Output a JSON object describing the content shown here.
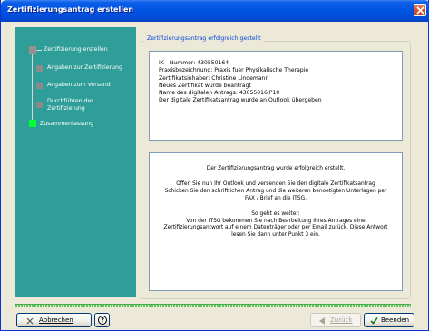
{
  "window": {
    "title": "Zertifizierungsantrag erstellen"
  },
  "sidebar": {
    "steps": [
      {
        "label": "Zertifizierung erstellen"
      },
      {
        "label": "Angaben zur Zertifizierung"
      },
      {
        "label": "Angaben zum Versand"
      },
      {
        "label_line1": "Durchführen der",
        "label_line2": "Zertifizierung"
      },
      {
        "label": "Zusammenfassung",
        "active": true
      }
    ]
  },
  "group": {
    "legend": "Zertifizierungsantrag erfolgreich gestellt"
  },
  "info": {
    "lines": [
      "IK - Nummer: 430550164",
      "Praxisbezeichnung: Praxis fuer Physikalische Therapie",
      "Zertifikatsinhaber: Christine Lindemann",
      "Neues Zertifikat wurde beantragt",
      "Name des digitalen Antrags: 43055016.P10",
      "Der digitale Zertifikatsantrag wurde an Outlook übergeben"
    ]
  },
  "message": {
    "line1": "Der Zertifizierungsantrag wurde erfolgreich erstellt.",
    "p2_1": "Öffen Sie nun Ihr Outlook und versenden Sie den digitale Zertifikatsantrag",
    "p2_2": "Schicken Sie den schriftlichen Antrag und die weiteren benoetigten Unterlagen per",
    "p2_3": "FAX / Brief an die ITSG.",
    "p3_1": "So geht es weiter:",
    "p3_2": "Von der ITSG bekommen Sie nach Bearbeitung Ihres Antrages eine",
    "p3_3": "Zertifizierungsantwort auf einem Datenträger oder per Email zurück. Diese Antwort",
    "p3_4": "lesen Sie dann unter Punkt 3 ein."
  },
  "buttons": {
    "cancel_label": "Abbrechen",
    "help_label": "?",
    "back_label": "Zurück",
    "finish_label": "Beenden"
  },
  "colors": {
    "sidebar": "#2f9e98",
    "active_step": "#00ff33",
    "legend": "#0046d5",
    "titlebar": "#0054e3"
  }
}
